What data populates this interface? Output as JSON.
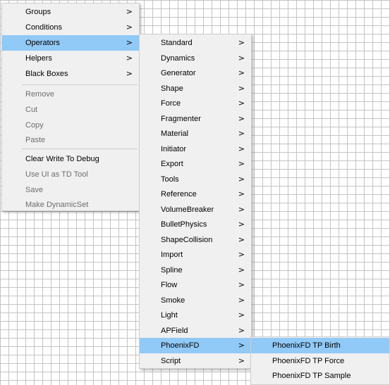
{
  "main_menu": {
    "items": [
      {
        "label": "Groups",
        "arrow": ">"
      },
      {
        "label": "Conditions",
        "arrow": ">"
      },
      {
        "label": "Operators",
        "arrow": ">"
      },
      {
        "label": "Helpers",
        "arrow": ">"
      },
      {
        "label": "Black Boxes",
        "arrow": ">"
      },
      {
        "label": "Remove"
      },
      {
        "label": "Cut"
      },
      {
        "label": "Copy"
      },
      {
        "label": "Paste"
      },
      {
        "label": "Clear Write To Debug"
      },
      {
        "label": "Use UI as TD Tool"
      },
      {
        "label": "Save"
      },
      {
        "label": "Make DynamicSet"
      }
    ]
  },
  "operators_menu": {
    "items": [
      {
        "label": "Standard"
      },
      {
        "label": "Dynamics"
      },
      {
        "label": "Generator"
      },
      {
        "label": "Shape"
      },
      {
        "label": "Force"
      },
      {
        "label": "Fragmenter"
      },
      {
        "label": "Material"
      },
      {
        "label": "Initiator"
      },
      {
        "label": "Export"
      },
      {
        "label": "Tools"
      },
      {
        "label": "Reference"
      },
      {
        "label": "VolumeBreaker"
      },
      {
        "label": "BulletPhysics"
      },
      {
        "label": "ShapeCollision"
      },
      {
        "label": "Import"
      },
      {
        "label": "Spline"
      },
      {
        "label": "Flow"
      },
      {
        "label": "Smoke"
      },
      {
        "label": "Light"
      },
      {
        "label": "APField"
      },
      {
        "label": "PhoenixFD"
      },
      {
        "label": "Script"
      }
    ],
    "arrow": ">"
  },
  "phoenixfd_menu": {
    "items": [
      {
        "label": "PhoenixFD TP Birth"
      },
      {
        "label": "PhoenixFD TP Force"
      },
      {
        "label": "PhoenixFD TP Sample"
      }
    ]
  },
  "colors": {
    "highlight": "#91c9f7",
    "menu_bg": "#f0f0f0",
    "disabled_text": "#6d6d6d",
    "grid_line": "#c4c4c4"
  }
}
